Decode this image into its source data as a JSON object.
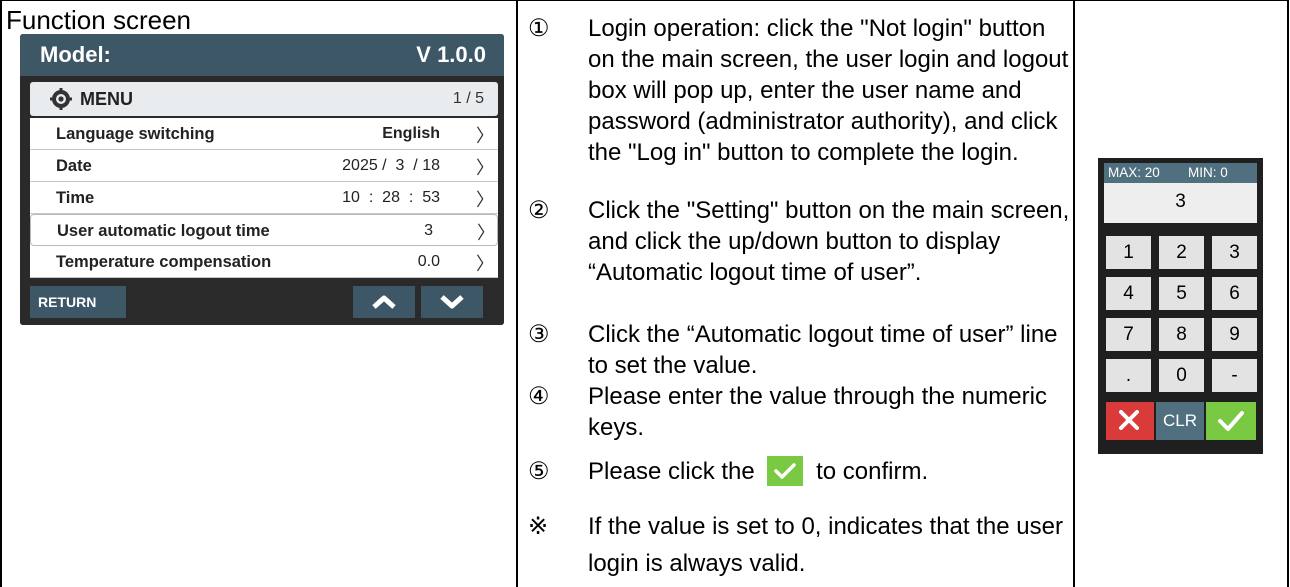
{
  "function_screen": {
    "title": "Function screen",
    "model_label": "Model:",
    "version": "V 1.0.0",
    "menu_icon": "gear-icon",
    "menu_label": "MENU",
    "menu_page": "1 / 5",
    "rows": [
      {
        "label": "Language switching",
        "value": "English"
      },
      {
        "label": "Date",
        "value": "2025 /  3  / 18"
      },
      {
        "label": "Time",
        "value": "10  :  28  :  53"
      },
      {
        "label": "User automatic logout time",
        "value": "3"
      },
      {
        "label": "Temperature compensation",
        "value": "0.0"
      }
    ],
    "chevron": "〉",
    "return_label": "RETURN",
    "up_icon": "chevron-up-icon",
    "down_icon": "chevron-down-icon"
  },
  "steps": [
    {
      "num": "①",
      "text": "Login operation: click the \"Not login\" button on the main screen, the user login and logout box will pop up, enter the user name and password (administrator authority), and click the \"Log in\" button to complete the login."
    },
    {
      "num": "②",
      "text": "Click the \"Setting\" button on the main screen, and click the up/down button to display “Automatic logout time of user”."
    },
    {
      "num": "③",
      "text": "Click the “Automatic logout time of user” line to set the value."
    },
    {
      "num": "④",
      "text": "Please enter the value through the numeric keys."
    },
    {
      "num": "⑤",
      "text_before": "Please click the",
      "text_after": "to confirm."
    },
    {
      "num": "※",
      "text": "If the value is set to 0, indicates that the user login is always valid."
    }
  ],
  "keypad": {
    "max_label": "MAX: 20",
    "min_label": "MIN: 0",
    "display_value": "3",
    "keys": [
      "1",
      "2",
      "3",
      "4",
      "5",
      "6",
      "7",
      "8",
      "9",
      ".",
      "0",
      "-"
    ],
    "clr_label": "CLR",
    "cancel_icon": "close-icon",
    "confirm_icon": "check-icon",
    "colors": {
      "header": "#51707f",
      "cancel": "#d93a3a",
      "confirm": "#7ac943"
    }
  }
}
